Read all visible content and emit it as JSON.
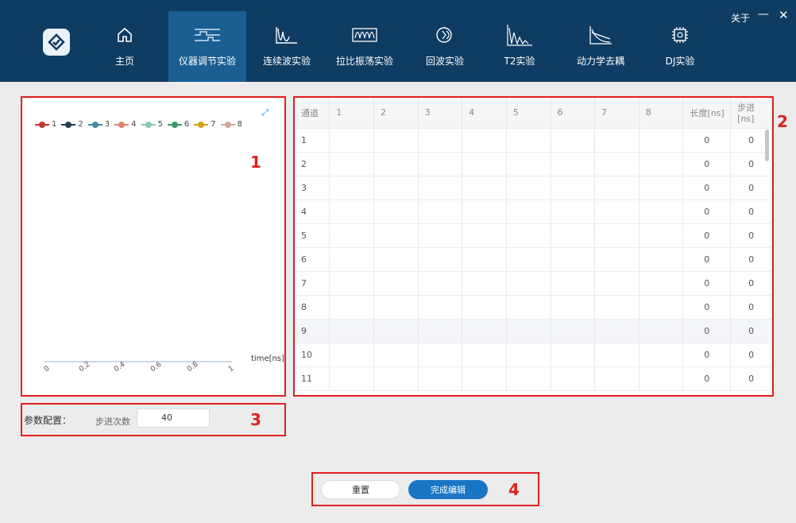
{
  "nav": {
    "items": [
      {
        "label": "主页",
        "icon": "home-icon"
      },
      {
        "label": "仪器调节实验",
        "icon": "pulse-sequence-icon",
        "active": true
      },
      {
        "label": "连续波实验",
        "icon": "continuous-wave-icon"
      },
      {
        "label": "拉比振荡实验",
        "icon": "rabi-oscillation-icon"
      },
      {
        "label": "回波实验",
        "icon": "echo-icon"
      },
      {
        "label": "T2实验",
        "icon": "decay-icon"
      },
      {
        "label": "动力学去耦",
        "icon": "dynamical-decoupling-icon"
      },
      {
        "label": "DJ实验",
        "icon": "chip-icon"
      }
    ],
    "about": "关于",
    "minimize": "—",
    "close": "✕"
  },
  "chart": {
    "legend": [
      "1",
      "2",
      "3",
      "4",
      "5",
      "6",
      "7",
      "8"
    ],
    "legend_colors": [
      "#c0392b",
      "#2c3e50",
      "#3b8f99",
      "#e0826a",
      "#8fc7b6",
      "#3a9a6a",
      "#d4a017",
      "#d4a5a0"
    ],
    "ticks": [
      "0",
      "0.2",
      "0.4",
      "0.6",
      "0.8",
      "1"
    ],
    "xlabel": "time[ns]"
  },
  "table": {
    "headers": [
      "通道",
      "1",
      "2",
      "3",
      "4",
      "5",
      "6",
      "7",
      "8",
      "长度[ns]",
      "步进[ns]"
    ],
    "rows": [
      {
        "ch": "1",
        "len": "0",
        "step": "0"
      },
      {
        "ch": "2",
        "len": "0",
        "step": "0"
      },
      {
        "ch": "3",
        "len": "0",
        "step": "0"
      },
      {
        "ch": "4",
        "len": "0",
        "step": "0"
      },
      {
        "ch": "5",
        "len": "0",
        "step": "0"
      },
      {
        "ch": "6",
        "len": "0",
        "step": "0"
      },
      {
        "ch": "7",
        "len": "0",
        "step": "0"
      },
      {
        "ch": "8",
        "len": "0",
        "step": "0"
      },
      {
        "ch": "9",
        "len": "0",
        "step": "0"
      },
      {
        "ch": "10",
        "len": "0",
        "step": "0"
      },
      {
        "ch": "11",
        "len": "0",
        "step": "0"
      }
    ]
  },
  "params": {
    "label": "参数配置：",
    "step_label": "步进次数",
    "step_value": "40"
  },
  "actions": {
    "reset": "重置",
    "done": "完成编辑"
  },
  "markers": [
    "1",
    "2",
    "3",
    "4"
  ]
}
